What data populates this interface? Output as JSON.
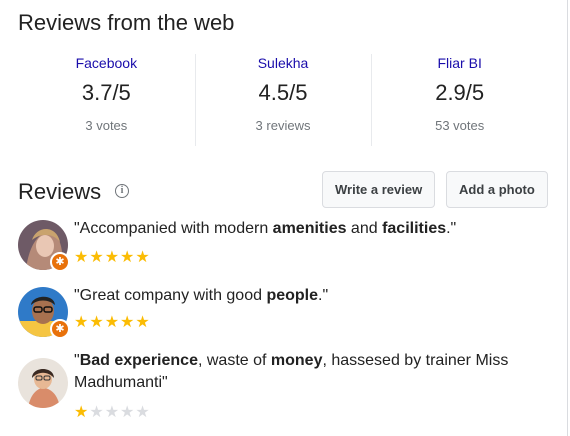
{
  "web_reviews": {
    "title": "Reviews from the web",
    "sources": [
      {
        "name": "Facebook",
        "rating": "3.7/5",
        "count": "3 votes"
      },
      {
        "name": "Sulekha",
        "rating": "4.5/5",
        "count": "3 reviews"
      },
      {
        "name": "Fliar BI",
        "rating": "2.9/5",
        "count": "53 votes"
      }
    ]
  },
  "reviews": {
    "title": "Reviews",
    "info_icon": "info-icon",
    "write_label": "Write a review",
    "photo_label": "Add a photo",
    "colors": {
      "star": "#fbbc04",
      "star_empty": "#dadce0",
      "badge": "#e8710a",
      "link": "#1a0dab"
    },
    "items": [
      {
        "segments": [
          {
            "text": "\"Accompanied with modern ",
            "bold": false
          },
          {
            "text": "amenities",
            "bold": true
          },
          {
            "text": " and ",
            "bold": false
          },
          {
            "text": "facilities",
            "bold": true
          },
          {
            "text": ".\"",
            "bold": false
          }
        ],
        "stars": 5,
        "local_guide": true
      },
      {
        "segments": [
          {
            "text": "\"Great company with good ",
            "bold": false
          },
          {
            "text": "people",
            "bold": true
          },
          {
            "text": ".\"",
            "bold": false
          }
        ],
        "stars": 5,
        "local_guide": true
      },
      {
        "segments": [
          {
            "text": "\"",
            "bold": false
          },
          {
            "text": "Bad experience",
            "bold": true
          },
          {
            "text": ", waste of ",
            "bold": false
          },
          {
            "text": "money",
            "bold": true
          },
          {
            "text": ", hassesed by trainer Miss Madhumanti\"",
            "bold": false
          }
        ],
        "stars": 1,
        "local_guide": false
      }
    ]
  }
}
